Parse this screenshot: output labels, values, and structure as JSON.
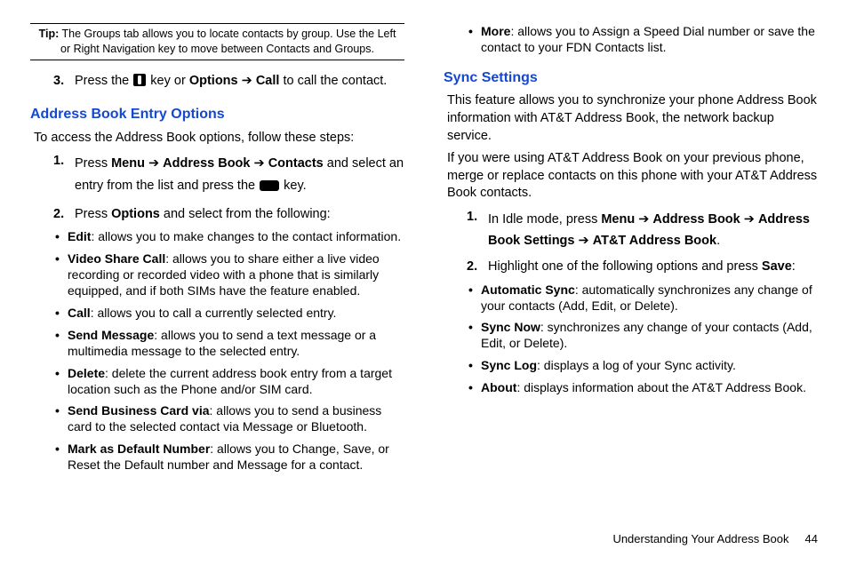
{
  "tip": {
    "label": "Tip:",
    "text": "The Groups tab allows you to locate contacts by group. Use the Left or Right Navigation key to move between Contacts and Groups."
  },
  "left": {
    "step3": {
      "num": "3.",
      "pre": "Press the ",
      "key_mid": " key or ",
      "opt": "Options",
      "arrow": " ➔ ",
      "call": "Call",
      "post": " to call the contact."
    },
    "h1": "Address Book Entry Options",
    "intro": "To access the Address Book options, follow these steps:",
    "s1": {
      "num": "1.",
      "pre": "Press ",
      "menu": "Menu",
      "arr1": " ➔ ",
      "ab": "Address Book",
      "arr2": " ➔ ",
      "con": "Contacts",
      "mid": " and select an entry from the list and press the ",
      "post": " key."
    },
    "s2": {
      "num": "2.",
      "pre": "Press ",
      "opt": "Options",
      "post": " and select from the following:"
    },
    "b": [
      {
        "t": "Edit",
        "d": ": allows you to make changes to the contact information."
      },
      {
        "t": "Video Share Call",
        "d": ": allows you to share either a live video recording or recorded video with a phone that is similarly equipped, and if both SIMs have the feature enabled."
      },
      {
        "t": "Call",
        "d": ": allows you to call a currently selected entry."
      },
      {
        "t": "Send Message",
        "d": ": allows you to send a text message or a multimedia message to the selected entry."
      },
      {
        "t": "Delete",
        "d": ": delete the current address book entry from a target location such as the Phone and/or SIM card."
      },
      {
        "t": "Send Business Card via",
        "d": ": allows you to send a business card to the selected contact via Message or Bluetooth."
      },
      {
        "t": "Mark as Default Number",
        "d": ": allows you to Change, Save, or Reset the Default number and Message for a contact."
      }
    ]
  },
  "right": {
    "topb": {
      "t": "More",
      "d": ": allows you to Assign a Speed Dial number or save the contact to your FDN Contacts list."
    },
    "h1": "Sync Settings",
    "p1": "This feature allows you to synchronize your phone Address Book information with AT&T Address Book, the network backup service.",
    "p2": "If you were using AT&T Address Book on your previous phone, merge or replace contacts on this phone with your AT&T Address Book contacts.",
    "s1": {
      "num": "1.",
      "pre": "In Idle mode, press ",
      "menu": "Menu",
      "a1": " ➔ ",
      "ab": "Address Book",
      "a2": " ➔ ",
      "abs": "Address Book Settings",
      "a3": " ➔ ",
      "att": "AT&T Address Book",
      "end": "."
    },
    "s2": {
      "num": "2.",
      "pre": "Highlight one of the following options and press ",
      "save": "Save",
      "end": ":"
    },
    "b": [
      {
        "t": "Automatic Sync",
        "d": ": automatically synchronizes any change of your contacts (Add, Edit, or Delete)."
      },
      {
        "t": "Sync Now",
        "d": ": synchronizes any change of your contacts (Add, Edit, or Delete)."
      },
      {
        "t": "Sync Log",
        "d": ": displays a log of your Sync activity."
      },
      {
        "t": "About",
        "d": ": displays information about the AT&T Address Book."
      }
    ]
  },
  "footer": {
    "text": "Understanding Your Address Book",
    "page": "44"
  }
}
